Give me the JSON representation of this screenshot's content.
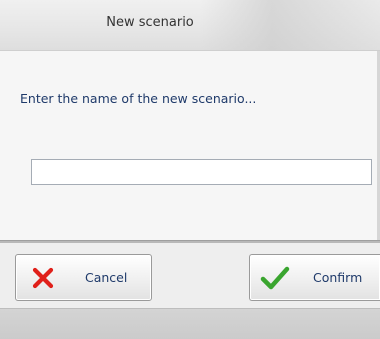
{
  "window": {
    "title": "New scenario"
  },
  "dialog": {
    "prompt": "Enter the name of the new scenario...",
    "name_input": {
      "value": "",
      "placeholder": ""
    }
  },
  "buttons": {
    "cancel": {
      "label": "Cancel",
      "icon": "close-icon",
      "icon_color": "#e0201a"
    },
    "confirm": {
      "label": "Confirm",
      "icon": "checkmark-icon",
      "icon_color": "#3aa52f"
    }
  },
  "colors": {
    "text": "#1f3a6a",
    "background": "#f6f6f6"
  }
}
